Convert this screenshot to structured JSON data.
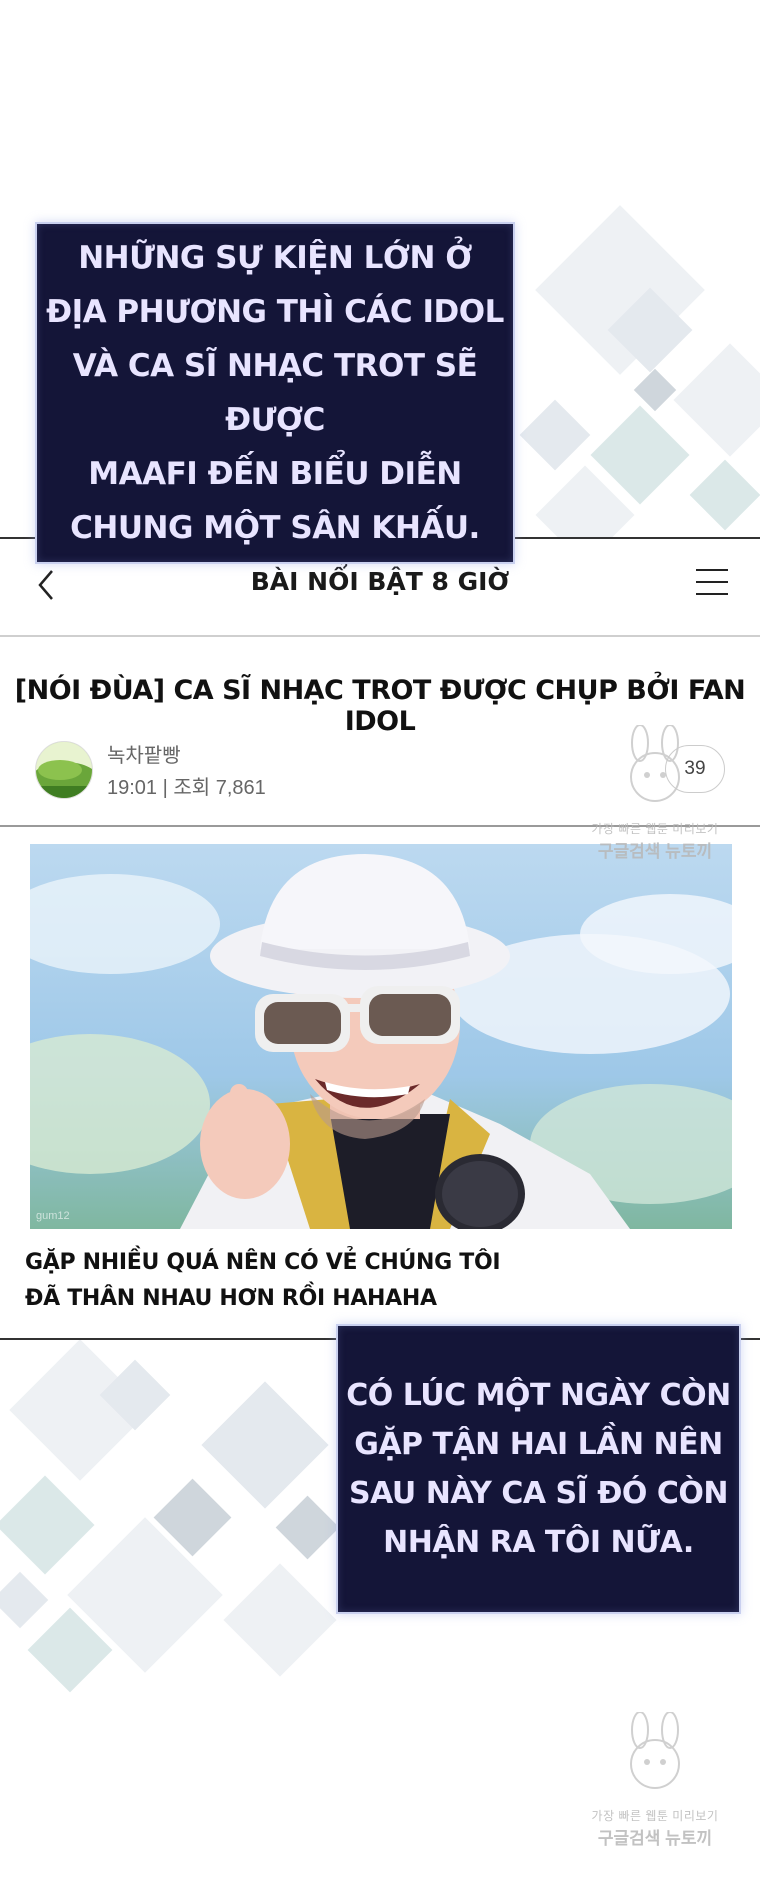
{
  "captions": {
    "first": "NHỮNG SỰ KIỆN LỚN Ở\nĐỊA PHƯƠNG THÌ CÁC IDOL\nVÀ CA SĨ NHẠC TROT SẼ ĐƯỢC\nMAAFI ĐẾN BIỂU DIỄN\nCHUNG MỘT SÂN KHẤU.",
    "second": "CÓ LÚC MỘT NGÀY CÒN\nGẶP TẬN HAI LẦN NÊN\nSAU NÀY CA SĨ ĐÓ CÒN\nNHẬN RA TÔI NỮA."
  },
  "nav": {
    "title": "BÀI NỔI BẬT 8 GIỜ",
    "back_icon": "chevron-left-icon",
    "menu_icon": "hamburger-menu-icon"
  },
  "post": {
    "title": "[NÓI ĐÙA] CA SĨ NHẠC TROT ĐƯỢC CHỤP BỞI FAN IDOL",
    "author": "녹차팥빵",
    "meta": "19:01 | 조회 7,861",
    "comment_count": "39",
    "image_caption": "GẶP NHIỀU QUÁ NÊN CÓ VẺ CHÚNG TÔI\nĐÃ THÂN NHAU HƠN RỒI HAHAHA",
    "image_credit": "gum12"
  },
  "watermark": {
    "line1": "가장 빠른 웹툰 미리보기",
    "line2": "구글검색 뉴토끼"
  },
  "colors": {
    "caption_bg": "#141538",
    "caption_text": "#e8e4ff",
    "caption_border": "#c9d0ef"
  }
}
